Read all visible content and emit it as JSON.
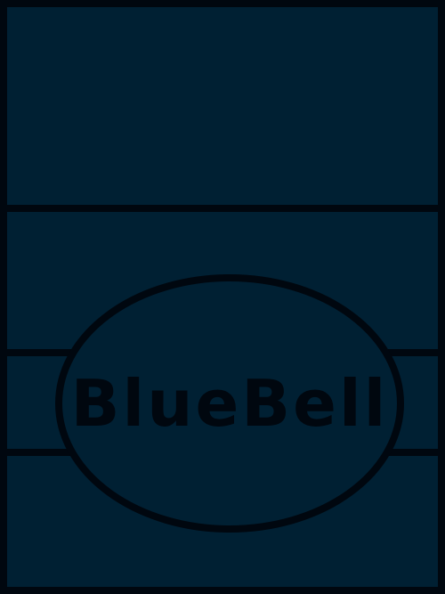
{
  "label": {
    "text": "BlueBell"
  },
  "colors": {
    "background": "#002033",
    "outline": "#00070f"
  }
}
